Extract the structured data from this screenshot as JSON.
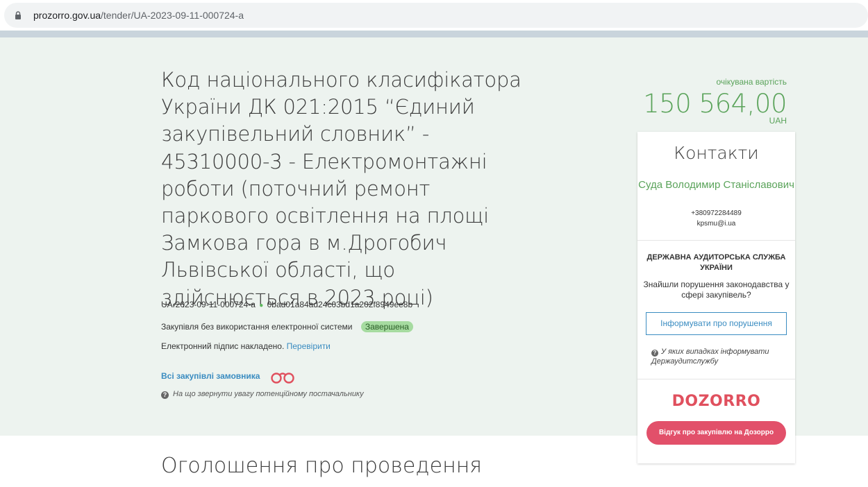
{
  "browser": {
    "url_host": "prozorro.gov.ua",
    "url_path": "/tender/UA-2023-09-11-000724-a"
  },
  "tender": {
    "title": "Код національного класифікатора України ДК 021:2015 “Єдиний закупівельний словник” - 45310000-3 - Електромонтажні роботи (поточний ремонт паркового освітлення на площі Замкова гора в м.Дрогобич Львівської області, що здійснюється в 2023 році)",
    "id": "UA-2023-09-11-000724-a",
    "hash": "0bad01a84ad24c03bd1a202f8949ee8b",
    "procurement_type": "Закупівля без використання електронної системи",
    "status": "Завершена",
    "signature_text": "Електронний підпис накладено.",
    "verify_link": "Перевірити",
    "all_purchases_link": "Всі закупівлі замовника",
    "hint": "На що звернути увагу потенційному постачальнику",
    "section_title": "Оголошення про проведення"
  },
  "price": {
    "label": "очікувана вартість",
    "value": "150 564,00",
    "currency": "UAH"
  },
  "contacts": {
    "title": "Контакти",
    "name": "Суда Володимир Станіславович",
    "phone": "+380972284489",
    "email": "kpsmu@i.ua"
  },
  "audit": {
    "title": "ДЕРЖАВНА АУДИТОРСЬКА СЛУЖБА УКРАЇНИ",
    "text": "Знайшли порушення законодавства у сфері закупівель?",
    "button": "Інформувати про порушення",
    "hint": "У яких випадках інформувати Держаудитслужбу"
  },
  "dozorro": {
    "logo": "DOZORRO",
    "button": "Відгук про закупівлю на Дозорро"
  },
  "colors": {
    "green": "#5aa35a",
    "link_blue": "#3a8cc1",
    "hero_bg": "#edf3ef",
    "dozorro_red": "#e2506a"
  }
}
